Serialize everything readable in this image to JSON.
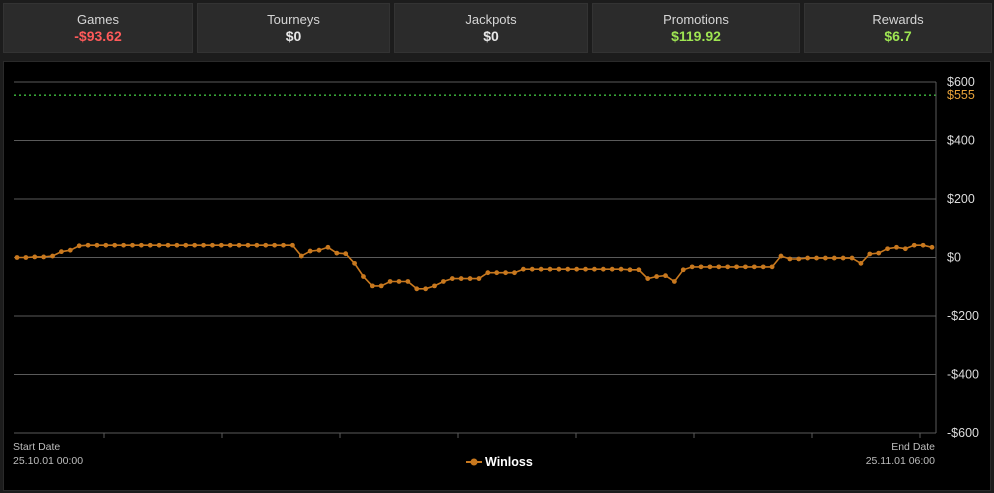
{
  "summary": {
    "cards": [
      {
        "label": "Games",
        "value": "-$93.62",
        "color": "#ff5a5a"
      },
      {
        "label": "Tourneys",
        "value": "$0",
        "color": "#e6e6e6"
      },
      {
        "label": "Jackpots",
        "value": "$0",
        "color": "#e6e6e6"
      },
      {
        "label": "Promotions",
        "value": "$119.92",
        "color": "#9ee552"
      },
      {
        "label": "Rewards",
        "value": "$6.7",
        "color": "#9ee552"
      }
    ]
  },
  "footer": {
    "start_label": "Start Date",
    "start_value": "25.10.01 00:00",
    "end_label": "End Date",
    "end_value": "25.11.01 06:00"
  },
  "colors": {
    "series": "#c8781e",
    "threshold": "#3fbf3f",
    "threshold_label": "#e8a33a",
    "grid": "#5a5a5a",
    "axis_text": "#dddddd"
  },
  "chart_data": {
    "type": "line",
    "ylim": [
      -600,
      600
    ],
    "yticks": [
      "$600",
      "$400",
      "$200",
      "$0",
      "-$200",
      "-$400",
      "-$600"
    ],
    "ytick_values": [
      600,
      400,
      200,
      0,
      -200,
      -400,
      -600
    ],
    "threshold": {
      "value": 555,
      "label": "$555"
    },
    "legend": {
      "position": "bottom-center"
    },
    "series": [
      {
        "name": "Winloss",
        "values": [
          0,
          0,
          2,
          2,
          5,
          20,
          25,
          40,
          42,
          42,
          42,
          42,
          42,
          42,
          42,
          42,
          42,
          42,
          42,
          42,
          42,
          42,
          42,
          42,
          42,
          42,
          42,
          42,
          42,
          42,
          42,
          42,
          5,
          22,
          25,
          35,
          15,
          13,
          -20,
          -65,
          -97,
          -97,
          -82,
          -82,
          -82,
          -107,
          -107,
          -97,
          -82,
          -72,
          -72,
          -72,
          -72,
          -52,
          -52,
          -52,
          -52,
          -40,
          -40,
          -40,
          -40,
          -40,
          -40,
          -40,
          -40,
          -40,
          -40,
          -40,
          -40,
          -42,
          -42,
          -72,
          -65,
          -62,
          -82,
          -42,
          -32,
          -32,
          -32,
          -32,
          -32,
          -32,
          -32,
          -32,
          -32,
          -32,
          5,
          -5,
          -5,
          -2,
          -2,
          -2,
          -2,
          -2,
          -2,
          -20,
          12,
          15,
          30,
          35,
          30,
          42,
          42,
          35
        ]
      }
    ]
  }
}
